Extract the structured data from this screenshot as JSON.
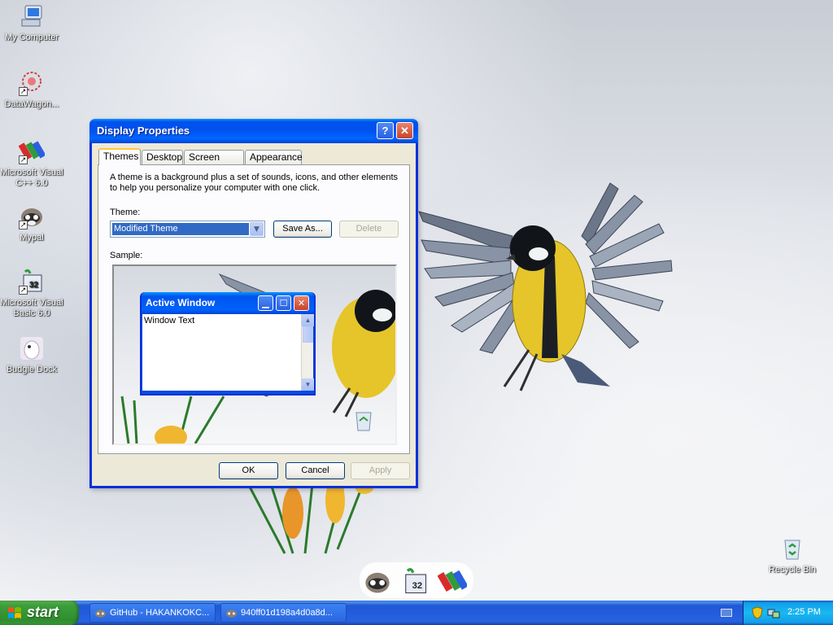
{
  "desktop": {
    "icons": [
      {
        "label": "My Computer",
        "icon": "my-computer-icon"
      },
      {
        "label": "DataWagon...",
        "icon": "datawagon-icon"
      },
      {
        "label": "Microsoft Visual C++ 6.0",
        "icon": "visual-cpp-icon"
      },
      {
        "label": "Mypal",
        "icon": "mypal-icon"
      },
      {
        "label": "Microsoft Visual Basic 6.0",
        "icon": "visual-basic-icon"
      },
      {
        "label": "Budgie Dock",
        "icon": "budgie-dock-icon"
      },
      {
        "label": "Recycle Bin",
        "icon": "recycle-bin-icon"
      }
    ]
  },
  "dialog": {
    "title": "Display Properties",
    "tabs": [
      "Themes",
      "Desktop",
      "Screen Saver",
      "Appearance"
    ],
    "active_tab": "Themes",
    "description": "A theme is a background plus a set of sounds, icons, and other elements to help you personalize your computer with one click.",
    "theme_label": "Theme:",
    "theme_value": "Modified Theme",
    "save_as_label": "Save As...",
    "delete_label": "Delete",
    "sample_label": "Sample:",
    "sample_window": {
      "title": "Active Window",
      "text": "Window Text"
    },
    "ok_label": "OK",
    "cancel_label": "Cancel",
    "apply_label": "Apply"
  },
  "taskbar": {
    "start_label": "start",
    "tasks": [
      {
        "label": "GitHub - HAKANKOKC...",
        "icon": "browser-icon"
      },
      {
        "label": "940ff01d198a4d0a8d...",
        "icon": "mypal-icon"
      }
    ],
    "clock": "2:25 PM"
  },
  "colors": {
    "titlebar_blue": "#0053ee",
    "start_green": "#3c9f3a",
    "selection_blue": "#316ac5"
  }
}
